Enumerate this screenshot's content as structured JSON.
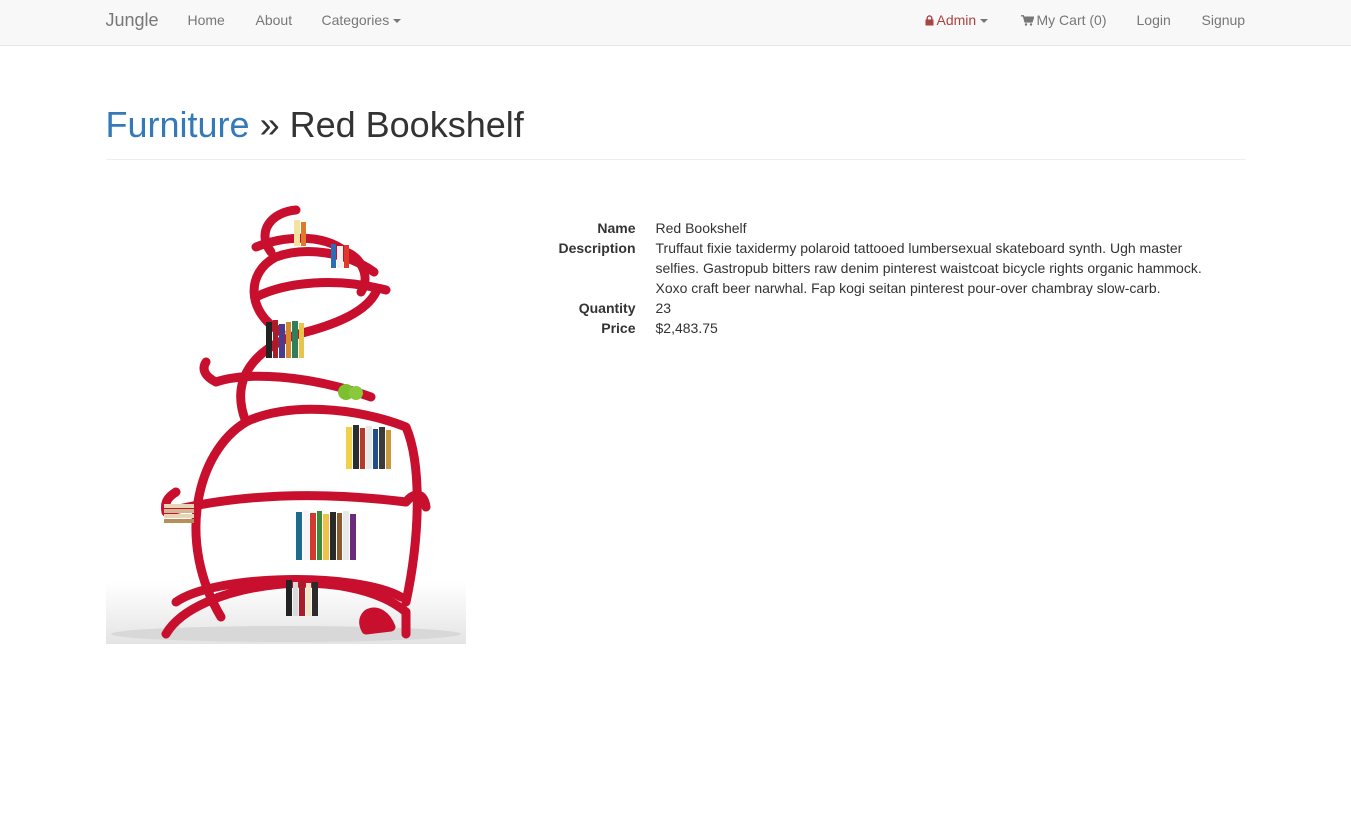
{
  "navbar": {
    "brand": "Jungle",
    "home": "Home",
    "about": "About",
    "categories": "Categories",
    "admin": "Admin",
    "cart": "My Cart (0)",
    "login": "Login",
    "signup": "Signup",
    "admin_color": "#a94442"
  },
  "header": {
    "category": "Furniture",
    "separator": "» ",
    "product": "Red Bookshelf"
  },
  "product": {
    "name_label": "Name",
    "name": "Red Bookshelf",
    "description_label": "Description",
    "description": "Truffaut fixie taxidermy polaroid tattooed lumbersexual skateboard synth. Ugh master selfies. Gastropub bitters raw denim pinterest waistcoat bicycle rights organic hammock. Xoxo craft beer narwhal. Fap kogi seitan pinterest pour-over chambray slow-carb.",
    "quantity_label": "Quantity",
    "quantity": "23",
    "price_label": "Price",
    "price": "$2,483.75",
    "image_icon": "red-bookshelf-image"
  }
}
